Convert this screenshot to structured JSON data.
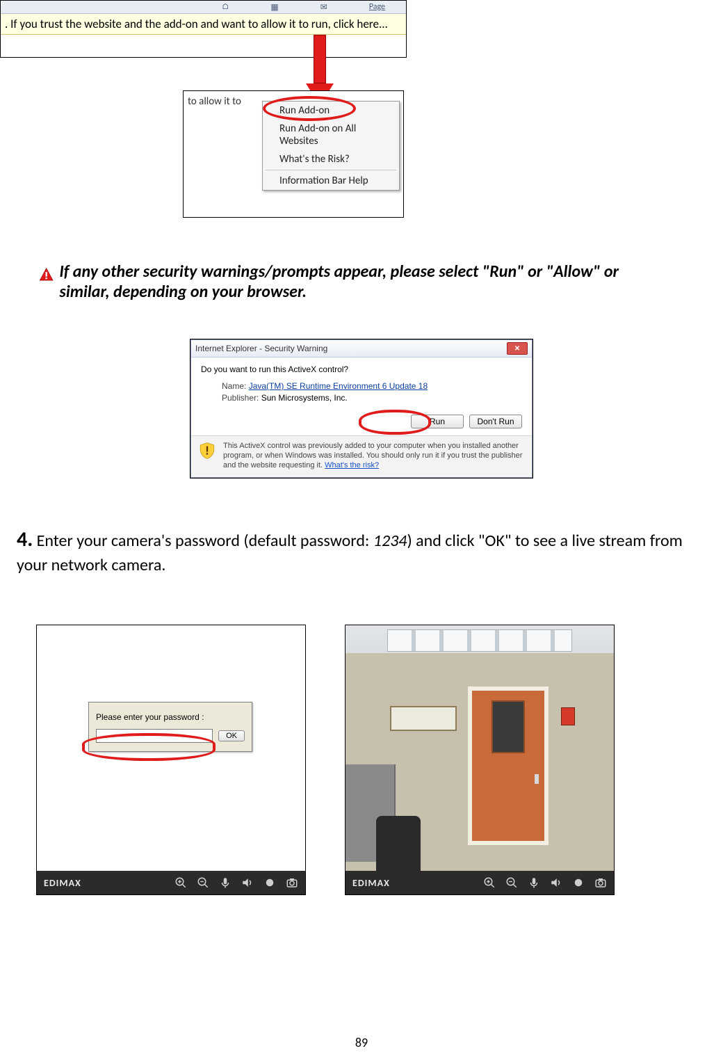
{
  "browserTop": {
    "pageLabel": "Page",
    "infobar": ". If you trust the website and the add-on and want to allow it to run, click here..."
  },
  "contextMenu": {
    "partial": "to allow it to",
    "items": [
      "Run Add-on",
      "Run Add-on on All Websites",
      "What's the Risk?"
    ],
    "sepAfter": 2,
    "lastItem": "Information Bar Help"
  },
  "warningNote": "If any other security warnings/prompts appear, please select \"Run\" or \"Allow\" or similar, depending on your browser.",
  "securityDialog": {
    "title": "Internet Explorer - Security Warning",
    "question": "Do you want to run this ActiveX control?",
    "nameLabel": "Name:",
    "nameValue": "Java(TM) SE Runtime Environment 6 Update 18",
    "publisherLabel": "Publisher:",
    "publisherValue": "Sun Microsystems, Inc.",
    "runBtn": "Run",
    "dontRunBtn": "Don't Run",
    "footerText": "This ActiveX control was previously added to your computer when you installed another program, or when Windows was installed. You should only run it if you trust the publisher and the website requesting it.",
    "footerLink": "What's the risk?"
  },
  "step4": {
    "number": "4.",
    "textA": "Enter your camera's password (default password: ",
    "default": "1234",
    "textB": ") and click \"OK\" to see a live stream from your network camera."
  },
  "passwordPrompt": {
    "label": "Please enter your password :",
    "ok": "OK"
  },
  "cameraBar": {
    "brand": "EDIMAX"
  },
  "pageNumber": "89"
}
